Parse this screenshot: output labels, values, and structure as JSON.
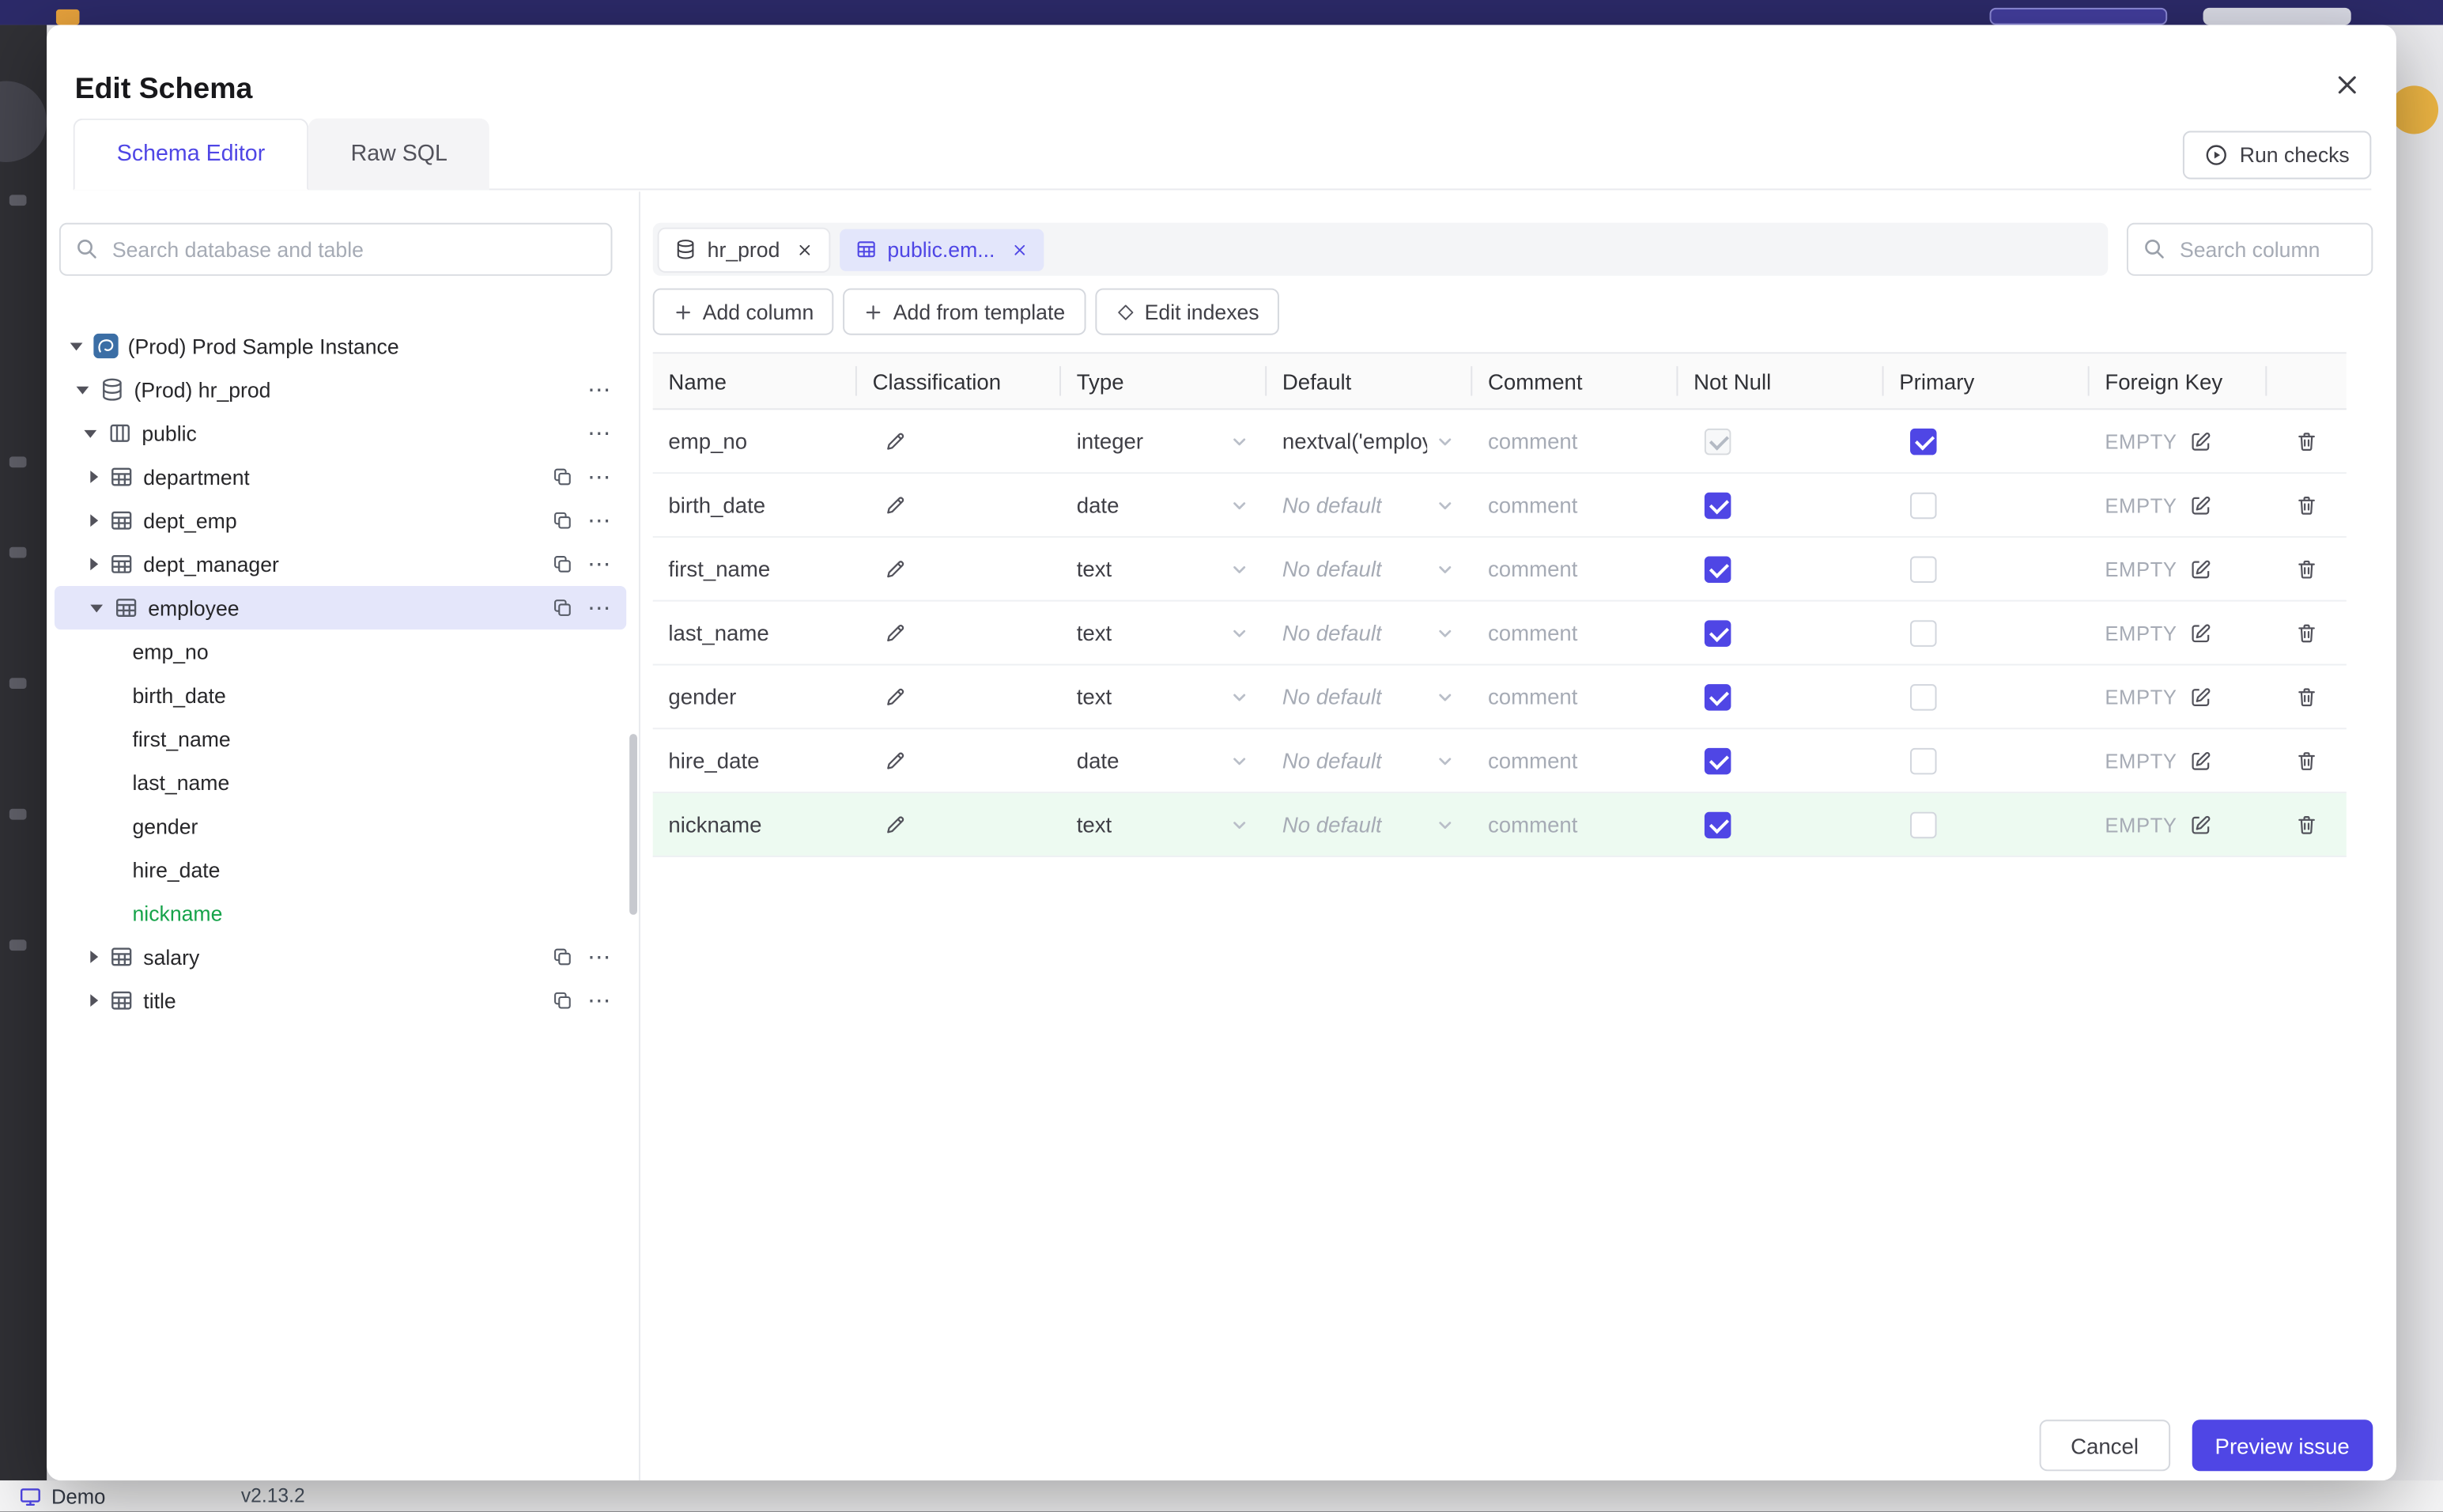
{
  "colors": {
    "accent": "#4f46e5",
    "new_column_green": "#16a34a"
  },
  "page": {
    "demo_label": "Demo",
    "version": "v2.13.2"
  },
  "modal": {
    "title": "Edit Schema",
    "tabs": [
      {
        "label": "Schema Editor",
        "active": true
      },
      {
        "label": "Raw SQL",
        "active": false
      }
    ],
    "run_checks_label": "Run checks",
    "sidebar": {
      "search_placeholder": "Search database and table",
      "tree": [
        {
          "label": "(Prod) Prod Sample Instance",
          "level": 0,
          "icon": "instance",
          "caret": "down",
          "copy": false,
          "menu": false,
          "selected": false,
          "new": false
        },
        {
          "label": "(Prod) hr_prod",
          "level": 1,
          "icon": "database",
          "caret": "down",
          "copy": false,
          "menu": true,
          "selected": false,
          "new": false
        },
        {
          "label": "public",
          "level": 2,
          "icon": "schema",
          "caret": "down",
          "copy": false,
          "menu": true,
          "selected": false,
          "new": false
        },
        {
          "label": "department",
          "level": 3,
          "icon": "table",
          "caret": "right",
          "copy": true,
          "menu": true,
          "selected": false,
          "new": false
        },
        {
          "label": "dept_emp",
          "level": 3,
          "icon": "table",
          "caret": "right",
          "copy": true,
          "menu": true,
          "selected": false,
          "new": false
        },
        {
          "label": "dept_manager",
          "level": 3,
          "icon": "table",
          "caret": "right",
          "copy": true,
          "menu": true,
          "selected": false,
          "new": false
        },
        {
          "label": "employee",
          "level": 3,
          "icon": "table",
          "caret": "down",
          "copy": true,
          "menu": true,
          "selected": true,
          "new": false
        },
        {
          "label": "emp_no",
          "level": 4,
          "icon": null,
          "caret": null,
          "copy": false,
          "menu": false,
          "selected": false,
          "new": false
        },
        {
          "label": "birth_date",
          "level": 4,
          "icon": null,
          "caret": null,
          "copy": false,
          "menu": false,
          "selected": false,
          "new": false
        },
        {
          "label": "first_name",
          "level": 4,
          "icon": null,
          "caret": null,
          "copy": false,
          "menu": false,
          "selected": false,
          "new": false
        },
        {
          "label": "last_name",
          "level": 4,
          "icon": null,
          "caret": null,
          "copy": false,
          "menu": false,
          "selected": false,
          "new": false
        },
        {
          "label": "gender",
          "level": 4,
          "icon": null,
          "caret": null,
          "copy": false,
          "menu": false,
          "selected": false,
          "new": false
        },
        {
          "label": "hire_date",
          "level": 4,
          "icon": null,
          "caret": null,
          "copy": false,
          "menu": false,
          "selected": false,
          "new": false
        },
        {
          "label": "nickname",
          "level": 4,
          "icon": null,
          "caret": null,
          "copy": false,
          "menu": false,
          "selected": false,
          "new": true
        },
        {
          "label": "salary",
          "level": 3,
          "icon": "table",
          "caret": "right",
          "copy": true,
          "menu": true,
          "selected": false,
          "new": false
        },
        {
          "label": "title",
          "level": 3,
          "icon": "table",
          "caret": "right",
          "copy": true,
          "menu": true,
          "selected": false,
          "new": false
        }
      ]
    },
    "workspace": {
      "open_tabs": [
        {
          "label": "hr_prod",
          "icon": "database",
          "active": false
        },
        {
          "label": "public.em...",
          "icon": "table",
          "active": true
        }
      ],
      "column_search_placeholder": "Search column",
      "toolbar": [
        {
          "label": "Add column",
          "icon": "plus"
        },
        {
          "label": "Add from template",
          "icon": "plus"
        },
        {
          "label": "Edit indexes",
          "icon": "diamond"
        }
      ],
      "table": {
        "headers": [
          "Name",
          "Classification",
          "Type",
          "Default",
          "Comment",
          "Not Null",
          "Primary",
          "Foreign Key"
        ],
        "comment_placeholder": "comment",
        "foreign_key_empty_label": "EMPTY",
        "rows": [
          {
            "name": "emp_no",
            "type": "integer",
            "default": "nextval('employ",
            "default_is_placeholder": false,
            "not_null": "checked-disabled",
            "primary": "checked",
            "is_new": false
          },
          {
            "name": "birth_date",
            "type": "date",
            "default": "No default",
            "default_is_placeholder": true,
            "not_null": "checked",
            "primary": "unchecked",
            "is_new": false
          },
          {
            "name": "first_name",
            "type": "text",
            "default": "No default",
            "default_is_placeholder": true,
            "not_null": "checked",
            "primary": "unchecked",
            "is_new": false
          },
          {
            "name": "last_name",
            "type": "text",
            "default": "No default",
            "default_is_placeholder": true,
            "not_null": "checked",
            "primary": "unchecked",
            "is_new": false
          },
          {
            "name": "gender",
            "type": "text",
            "default": "No default",
            "default_is_placeholder": true,
            "not_null": "checked",
            "primary": "unchecked",
            "is_new": false
          },
          {
            "name": "hire_date",
            "type": "date",
            "default": "No default",
            "default_is_placeholder": true,
            "not_null": "checked",
            "primary": "unchecked",
            "is_new": false
          },
          {
            "name": "nickname",
            "type": "text",
            "default": "No default",
            "default_is_placeholder": true,
            "not_null": "checked",
            "primary": "unchecked",
            "is_new": true
          }
        ]
      }
    },
    "footer": {
      "cancel_label": "Cancel",
      "primary_label": "Preview issue"
    }
  }
}
